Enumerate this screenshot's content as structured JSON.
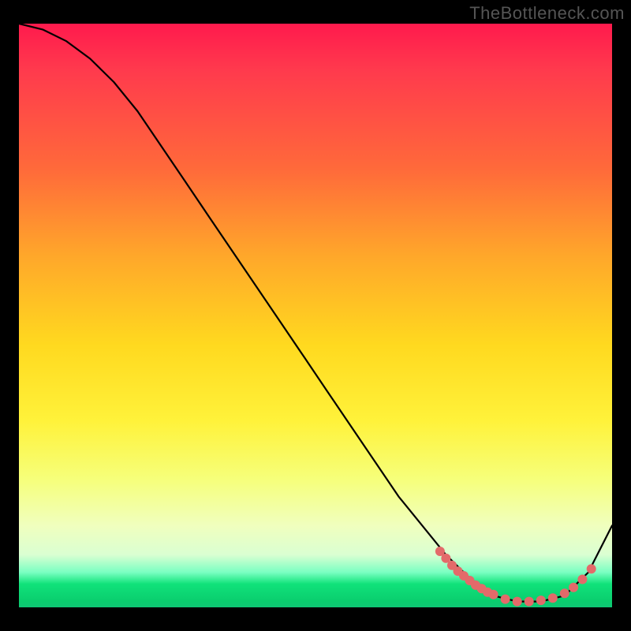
{
  "watermark": "TheBottleneck.com",
  "colors": {
    "background": "#000000",
    "curve": "#000000",
    "marker": "#e36a6a"
  },
  "chart_data": {
    "type": "line",
    "title": "",
    "xlabel": "",
    "ylabel": "",
    "xlim": [
      0,
      100
    ],
    "ylim": [
      0,
      100
    ],
    "grid": false,
    "series": [
      {
        "name": "bottleneck-curve",
        "x": [
          0,
          4,
          8,
          12,
          16,
          20,
          24,
          28,
          32,
          36,
          40,
          44,
          48,
          52,
          56,
          60,
          64,
          68,
          72,
          76,
          80,
          84,
          88,
          92,
          96,
          100
        ],
        "y": [
          100,
          99,
          97,
          94,
          90,
          85,
          79,
          73,
          67,
          61,
          55,
          49,
          43,
          37,
          31,
          25,
          19,
          14,
          9,
          5,
          2,
          1,
          1,
          2,
          6,
          14
        ]
      }
    ],
    "markers": {
      "name": "highlight-range",
      "color": "#e36a6a",
      "points": [
        {
          "x": 71,
          "y": 9.6
        },
        {
          "x": 72,
          "y": 8.4
        },
        {
          "x": 73,
          "y": 7.2
        },
        {
          "x": 74,
          "y": 6.2
        },
        {
          "x": 75,
          "y": 5.4
        },
        {
          "x": 76,
          "y": 4.6
        },
        {
          "x": 77,
          "y": 3.8
        },
        {
          "x": 78,
          "y": 3.2
        },
        {
          "x": 79,
          "y": 2.6
        },
        {
          "x": 80,
          "y": 2.2
        },
        {
          "x": 82,
          "y": 1.4
        },
        {
          "x": 84,
          "y": 1.0
        },
        {
          "x": 86,
          "y": 1.0
        },
        {
          "x": 88,
          "y": 1.2
        },
        {
          "x": 90,
          "y": 1.6
        },
        {
          "x": 92,
          "y": 2.4
        },
        {
          "x": 93.5,
          "y": 3.4
        },
        {
          "x": 95,
          "y": 4.8
        },
        {
          "x": 96.5,
          "y": 6.6
        }
      ]
    },
    "annotations": []
  }
}
